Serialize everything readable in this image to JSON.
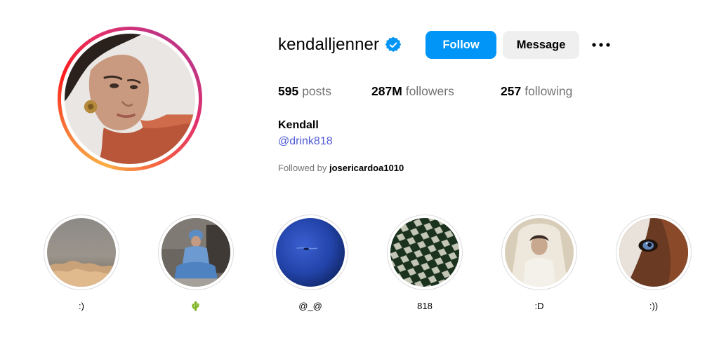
{
  "profile": {
    "username": "kendalljenner",
    "follow_label": "Follow",
    "message_label": "Message",
    "stats": {
      "posts_count": "595",
      "posts_label": "posts",
      "followers_count": "287M",
      "followers_label": "followers",
      "following_count": "257",
      "following_label": "following"
    },
    "bio": {
      "name": "Kendall",
      "link": "@drink818"
    },
    "followed_by_prefix": "Followed by",
    "followed_by_user": "josericardoa1010"
  },
  "highlights": [
    {
      "label": ":)"
    },
    {
      "label": "🌵"
    },
    {
      "label": "@_@"
    },
    {
      "label": "818"
    },
    {
      "label": ":D"
    },
    {
      "label": ":))"
    }
  ],
  "colors": {
    "follow_blue": "#0095f6",
    "verified_blue": "#0095f6",
    "link": "#4f5bd5",
    "secondary_text": "#737373"
  }
}
